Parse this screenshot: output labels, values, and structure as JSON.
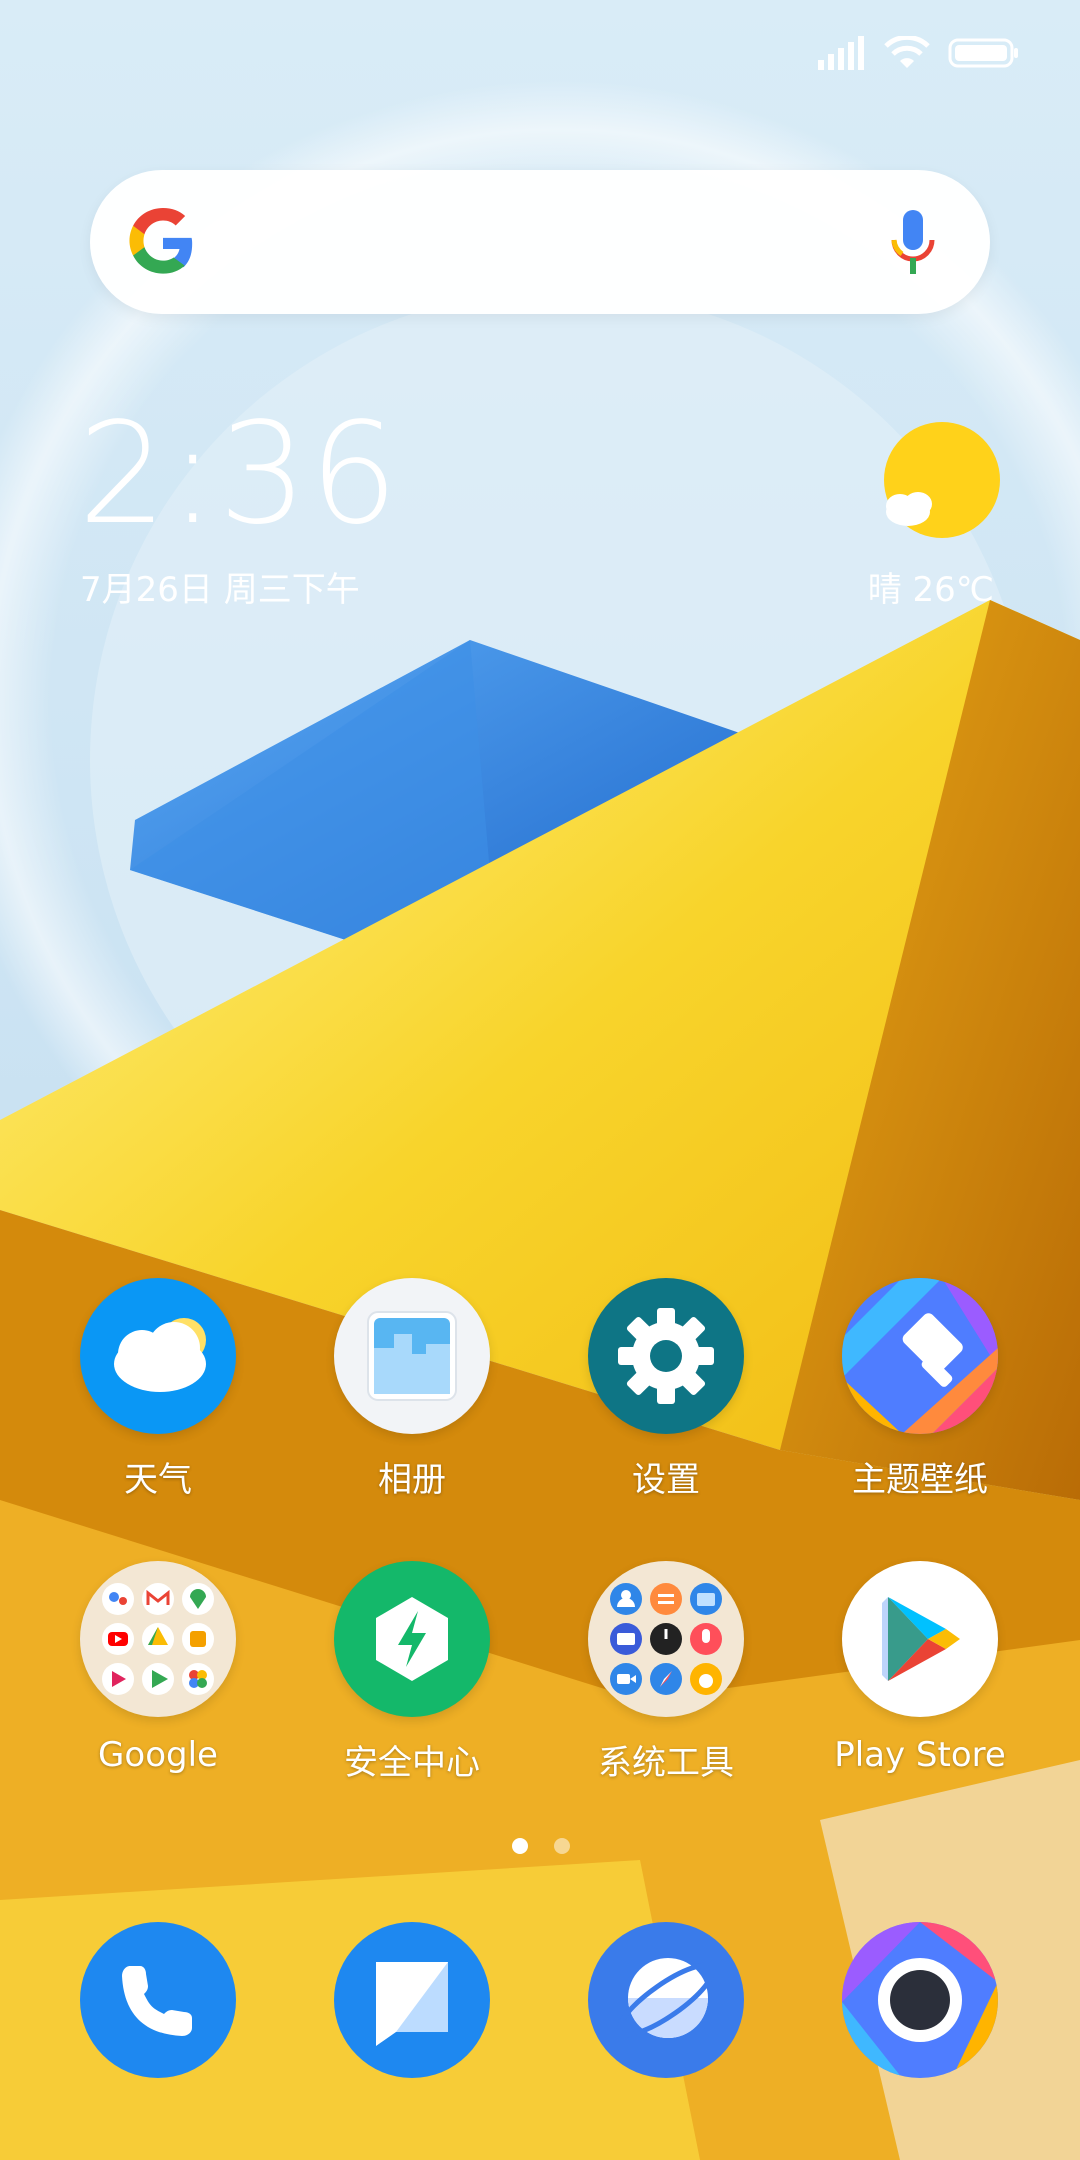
{
  "status_bar": {
    "icons": [
      "signal-icon",
      "wifi-icon",
      "battery-icon"
    ]
  },
  "search": {
    "icon": "google-g-icon",
    "mic_icon": "mic-icon"
  },
  "clock": {
    "time": "2:36",
    "date": "7月26日 周三下午"
  },
  "weather": {
    "summary": "晴 26℃",
    "icon": "sun-cloud-icon"
  },
  "apps_row1": [
    {
      "label": "天气",
      "icon": "weather-app-icon"
    },
    {
      "label": "相册",
      "icon": "gallery-app-icon"
    },
    {
      "label": "设置",
      "icon": "settings-app-icon"
    },
    {
      "label": "主题壁纸",
      "icon": "themes-app-icon"
    }
  ],
  "apps_row2": [
    {
      "label": "Google",
      "icon": "google-folder-icon"
    },
    {
      "label": "安全中心",
      "icon": "security-app-icon"
    },
    {
      "label": "系统工具",
      "icon": "tools-folder-icon"
    },
    {
      "label": "Play Store",
      "icon": "play-store-icon"
    }
  ],
  "pager": {
    "pages": 2,
    "active": 1
  },
  "dock": [
    {
      "icon": "phone-icon"
    },
    {
      "icon": "messages-icon"
    },
    {
      "icon": "browser-icon"
    },
    {
      "icon": "camera-icon"
    }
  ],
  "colors": {
    "sky": "#cfe6f4",
    "yellow": "#f7cc2a",
    "orange": "#e49a10",
    "blue": "#2f86e8",
    "accent": "#0a97f5"
  }
}
